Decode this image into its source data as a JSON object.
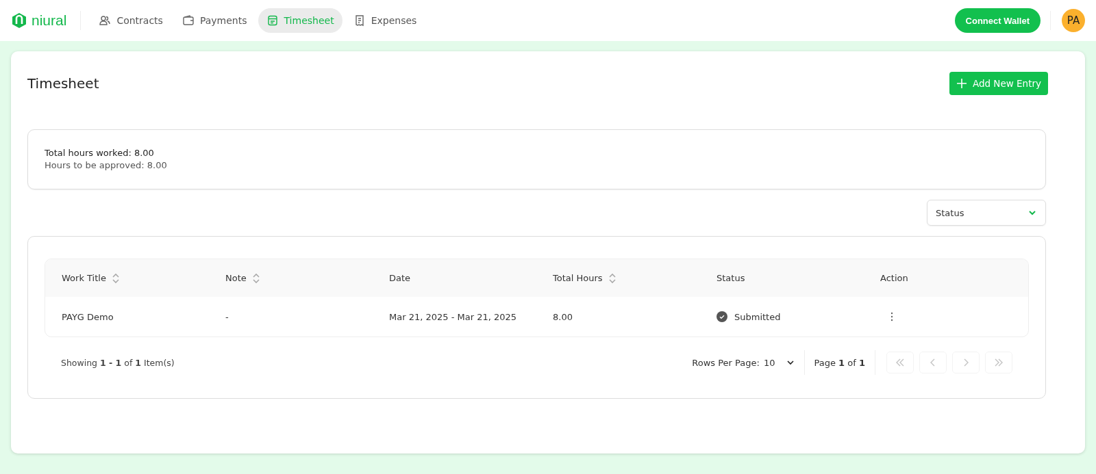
{
  "brand": {
    "name": "niural"
  },
  "nav": [
    {
      "label": "Contracts",
      "kind": "people",
      "selected": false
    },
    {
      "label": "Payments",
      "kind": "wallet",
      "selected": false
    },
    {
      "label": "Timesheet",
      "kind": "calendar",
      "selected": true
    },
    {
      "label": "Expenses",
      "kind": "receipt",
      "selected": false
    }
  ],
  "connect_button": "Connect Wallet",
  "avatar": "PA",
  "page": {
    "title": "Timesheet",
    "add_button": "Add New Entry"
  },
  "summary": [
    "Total hours worked: 8.00",
    "Hours to be approved: 8.00"
  ],
  "status_filter": {
    "placeholder": "Status"
  },
  "table": {
    "columns": [
      {
        "label": "Work Title",
        "sortable": true
      },
      {
        "label": "Note",
        "sortable": true
      },
      {
        "label": "Date",
        "sortable": false
      },
      {
        "label": "Total Hours",
        "sortable": true
      },
      {
        "label": "Status",
        "sortable": false
      },
      {
        "label": "Action",
        "sortable": false
      }
    ],
    "rows": [
      {
        "work_title": "PAYG Demo",
        "note": "-",
        "date": "Mar 21, 2025 - Mar 21, 2025",
        "total_hours": "8.00",
        "status": "Submitted"
      }
    ]
  },
  "footer": {
    "showing": "Showing **1 - 1** of **1** Item(s)",
    "rows_per_page_label": "Rows Per Page:",
    "rows_per_page": "10",
    "page": "Page **1** of **1**",
    "pager": [
      {
        "kind": "first",
        "disabled": true
      },
      {
        "kind": "prev",
        "disabled": true
      },
      {
        "kind": "next",
        "disabled": true
      },
      {
        "kind": "last",
        "disabled": true
      }
    ]
  }
}
